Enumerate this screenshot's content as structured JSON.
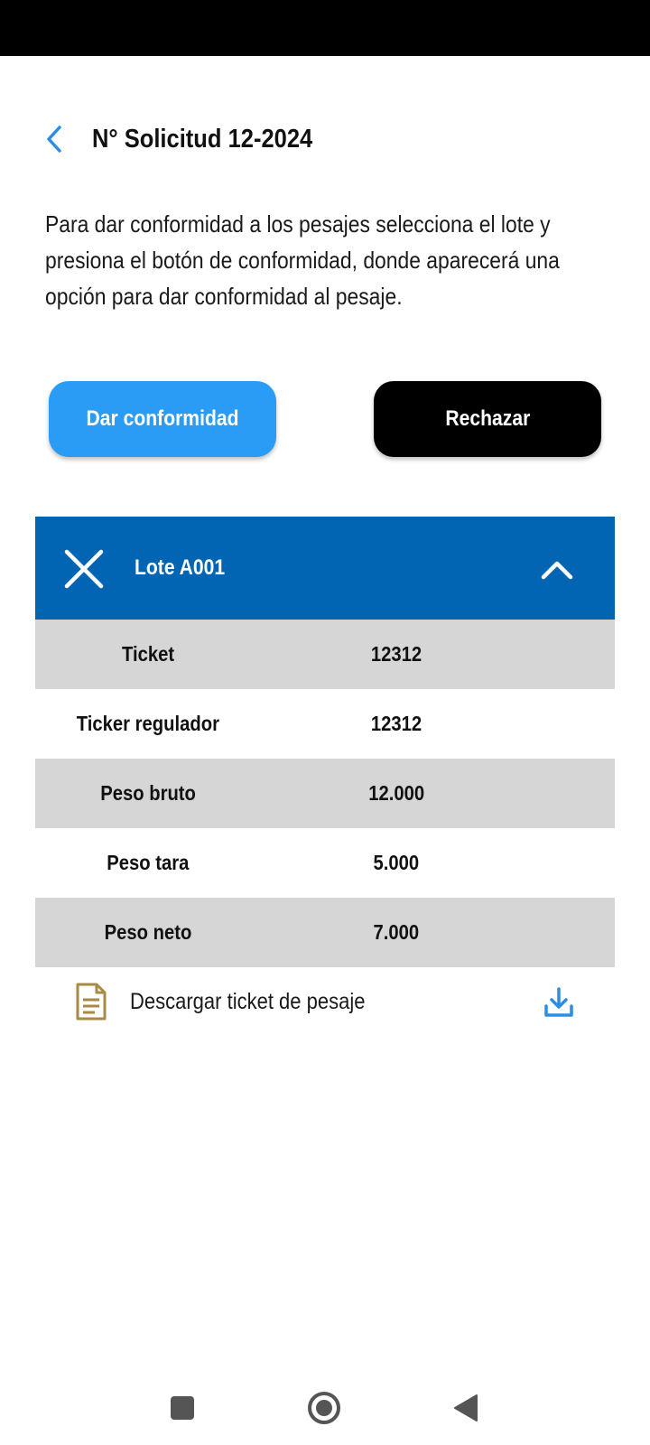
{
  "header": {
    "title": "N° Solicitud 12-2024",
    "back_icon": "chevron-left-icon"
  },
  "instructions": "Para dar conformidad a los pesajes selecciona el lote y presiona el botón de conformidad, donde aparecerá una opción para dar conformidad al pesaje.",
  "actions": {
    "accept_label": "Dar conformidad",
    "reject_label": "Rechazar"
  },
  "lote": {
    "title": "Lote A001",
    "rows": [
      {
        "label": "Ticket",
        "value": "12312"
      },
      {
        "label": "Ticker regulador",
        "value": "12312"
      },
      {
        "label": "Peso bruto",
        "value": "12.000"
      },
      {
        "label": "Peso tara",
        "value": "5.000"
      },
      {
        "label": "Peso neto",
        "value": "7.000"
      }
    ]
  },
  "download": {
    "label": "Descargar ticket de pesaje"
  },
  "colors": {
    "accent": "#2b9cf5",
    "lote_header": "#0265b3",
    "row_shade": "#d6d6d6",
    "doc_icon": "#a88a45"
  }
}
